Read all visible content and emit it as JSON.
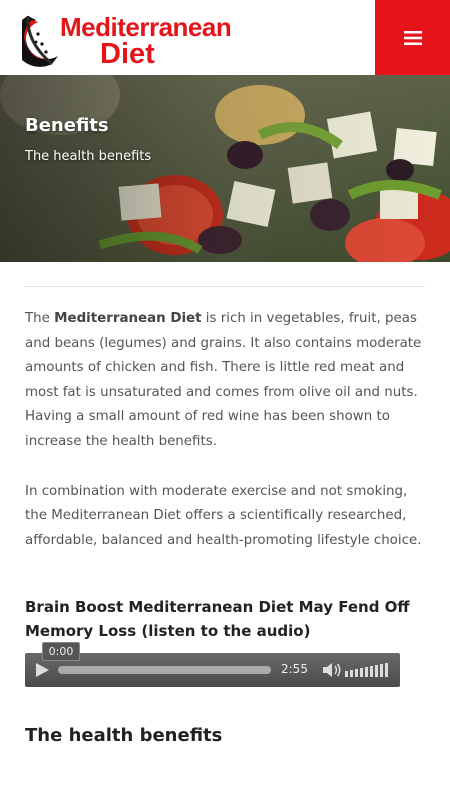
{
  "header": {
    "logo_line1": "Mediterranean",
    "logo_line2": "Diet",
    "menu_icon": "hamburger-menu-icon",
    "brand_color": "#e8141b"
  },
  "hero": {
    "title": "Benefits",
    "subtitle": "The health benefits"
  },
  "body": {
    "para1_prefix": "The ",
    "para1_bold": "Mediterranean Diet",
    "para1_rest": " is rich in vegetables, fruit, peas and beans (legumes) and grains. It also contains moderate amounts of chicken and fish. There is little red meat and most fat is unsaturated and comes from olive oil and nuts. Having a small amount of red wine has been shown to increase the health benefits.",
    "para2": "In combination with moderate exercise and not smoking, the Mediterranean Diet offers a scientifically researched, affordable, balanced and health-promoting lifestyle choice."
  },
  "audio": {
    "title": "Brain Boost Mediterranean Diet May Fend Off Memory Loss (listen to the audio)",
    "current_time": "0:00",
    "duration": "2:55"
  },
  "section": {
    "title": "The health benefits"
  }
}
